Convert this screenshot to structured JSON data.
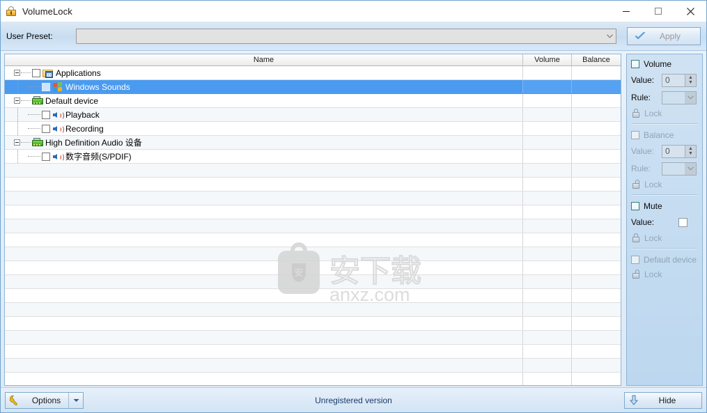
{
  "window": {
    "title": "VolumeLock",
    "icon": "padlock-icon",
    "controls": {
      "minimize": "minimize-icon",
      "maximize": "maximize-icon",
      "close": "close-icon"
    }
  },
  "preset_bar": {
    "label": "User Preset:",
    "combo_value": "",
    "combo_placeholder": "",
    "apply_label": "Apply",
    "apply_icon": "check-icon",
    "apply_enabled": false
  },
  "tree": {
    "columns": [
      "Name",
      "Volume",
      "Balance"
    ],
    "rows": [
      {
        "label": "Applications",
        "depth": 0,
        "icon": "applications-icon",
        "expander": "minus",
        "checkbox": true,
        "selected": false,
        "volume": "",
        "balance": ""
      },
      {
        "label": "Windows Sounds",
        "depth": 1,
        "icon": "windows-flag-icon",
        "expander": "none",
        "checkbox": true,
        "selected": true,
        "volume": "",
        "balance": ""
      },
      {
        "label": "Default device",
        "depth": 0,
        "icon": "sound-card-icon",
        "expander": "minus",
        "checkbox": false,
        "selected": false,
        "volume": "",
        "balance": ""
      },
      {
        "label": "Playback",
        "depth": 1,
        "icon": "speaker-icon",
        "expander": "none",
        "checkbox": true,
        "selected": false,
        "volume": "",
        "balance": ""
      },
      {
        "label": "Recording",
        "depth": 1,
        "icon": "speaker-icon",
        "expander": "none",
        "checkbox": true,
        "selected": false,
        "volume": "",
        "balance": ""
      },
      {
        "label": "High Definition Audio 设备",
        "depth": 0,
        "icon": "sound-card-icon",
        "expander": "minus",
        "checkbox": false,
        "selected": false,
        "volume": "",
        "balance": ""
      },
      {
        "label": "数字音频(S/PDIF)",
        "depth": 1,
        "icon": "speaker-icon",
        "expander": "none",
        "checkbox": true,
        "selected": false,
        "volume": "",
        "balance": ""
      }
    ],
    "empty_row_count": 16
  },
  "watermark": {
    "cn_text": "安下载",
    "domain_text": "anxz.com",
    "badge_char": "安",
    "color": "#d2d2d2"
  },
  "settings": {
    "volume": {
      "title": "Volume",
      "enabled": true,
      "checked": false,
      "value_label": "Value:",
      "value": "0",
      "rule_label": "Rule:",
      "rule_value": "",
      "lock_label": "Lock",
      "lock_icon": "padlock-closed-icon"
    },
    "balance": {
      "title": "Balance",
      "enabled": false,
      "checked": false,
      "value_label": "Value:",
      "value": "0",
      "rule_label": "Rule:",
      "rule_value": "",
      "lock_label": "Lock",
      "lock_icon": "padlock-open-icon"
    },
    "mute": {
      "title": "Mute",
      "enabled": true,
      "checked": false,
      "value_label": "Value:",
      "value_checked": false,
      "lock_label": "Lock",
      "lock_icon": "padlock-closed-icon"
    },
    "default_device": {
      "title": "Default device",
      "enabled": false,
      "checked": false,
      "lock_label": "Lock",
      "lock_icon": "padlock-open-icon"
    }
  },
  "status_bar": {
    "options_label": "Options",
    "options_icon": "wrench-icon",
    "options_dropdown_icon": "chevron-down-icon",
    "status_text": "Unregistered version",
    "hide_label": "Hide",
    "hide_icon": "arrow-down-icon"
  },
  "colors": {
    "accent": "#4a9bf0",
    "title_bar": "#ffffff",
    "panel": "#cfe2f3",
    "status_text": "#1d3a6b",
    "border": "#8fb4d4"
  }
}
